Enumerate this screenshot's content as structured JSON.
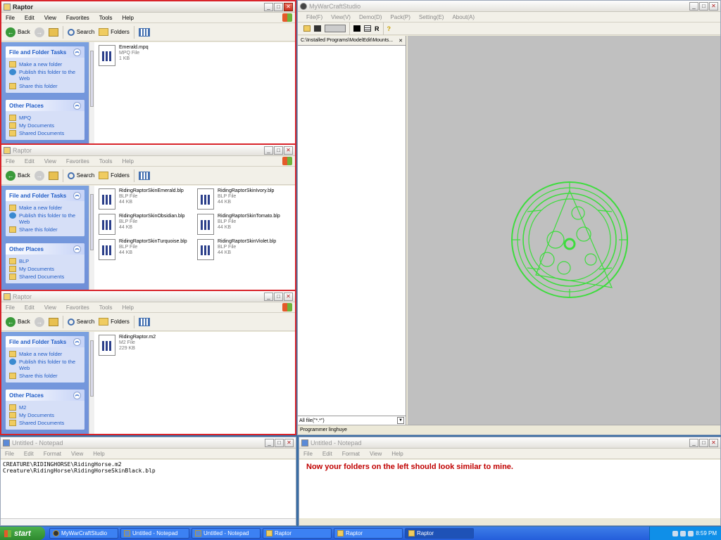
{
  "explorer_windows": [
    {
      "title": "Raptor",
      "menu": [
        "File",
        "Edit",
        "View",
        "Favorites",
        "Tools",
        "Help"
      ],
      "toolbar": {
        "back": "Back",
        "search": "Search",
        "folders": "Folders"
      },
      "tasks_panel": {
        "title": "File and Folder Tasks",
        "items": [
          "Make a new folder",
          "Publish this folder to the Web",
          "Share this folder"
        ]
      },
      "places_panel": {
        "title": "Other Places",
        "items": [
          "MPQ",
          "My Documents",
          "Shared Documents"
        ]
      },
      "files": [
        {
          "name": "Emerald.mpq",
          "type": "MPQ File",
          "size": "1 KB"
        }
      ]
    },
    {
      "title": "Raptor",
      "menu": [
        "File",
        "Edit",
        "View",
        "Favorites",
        "Tools",
        "Help"
      ],
      "toolbar": {
        "back": "Back",
        "search": "Search",
        "folders": "Folders"
      },
      "tasks_panel": {
        "title": "File and Folder Tasks",
        "items": [
          "Make a new folder",
          "Publish this folder to the Web",
          "Share this folder"
        ]
      },
      "places_panel": {
        "title": "Other Places",
        "items": [
          "BLP",
          "My Documents",
          "Shared Documents"
        ]
      },
      "files": [
        {
          "name": "RidingRaptorSkinEmerald.blp",
          "type": "BLP File",
          "size": "44 KB"
        },
        {
          "name": "RidingRaptorSkinIvory.blp",
          "type": "BLP File",
          "size": "44 KB"
        },
        {
          "name": "RidingRaptorSkinObsidian.blp",
          "type": "BLP File",
          "size": "44 KB"
        },
        {
          "name": "RidingRaptorSkinTomato.blp",
          "type": "BLP File",
          "size": "44 KB"
        },
        {
          "name": "RidingRaptorSkinTurquoise.blp",
          "type": "BLP File",
          "size": "44 KB"
        },
        {
          "name": "RidingRaptorSkinViolet.blp",
          "type": "BLP File",
          "size": "44 KB"
        }
      ]
    },
    {
      "title": "Raptor",
      "menu": [
        "File",
        "Edit",
        "View",
        "Favorites",
        "Tools",
        "Help"
      ],
      "toolbar": {
        "back": "Back",
        "search": "Search",
        "folders": "Folders"
      },
      "tasks_panel": {
        "title": "File and Folder Tasks",
        "items": [
          "Make a new folder",
          "Publish this folder to the Web",
          "Share this folder"
        ]
      },
      "places_panel": {
        "title": "Other Places",
        "items": [
          "M2",
          "My Documents",
          "Shared Documents"
        ]
      },
      "files": [
        {
          "name": "RidingRaptor.m2",
          "type": "M2 File",
          "size": "229 KB"
        }
      ]
    }
  ],
  "mwcs": {
    "title": "MyWarCraftStudio",
    "menu": [
      "File(F)",
      "View(V)",
      "Demo(D)",
      "Pack(P)",
      "Setting(E)",
      "About(A)"
    ],
    "tool_r": "R",
    "tab_path": "C:\\Installed Programs\\ModelEdit\\Mounts...",
    "filter": "All file(\"*.*\")",
    "status": "Programmer linghuye"
  },
  "notepad_left": {
    "title": "Untitled - Notepad",
    "menu": [
      "File",
      "Edit",
      "Format",
      "View",
      "Help"
    ],
    "lines": [
      "CREATURE\\RIDINGHORSE\\RidingHorse.m2",
      "Creature\\RidingHorse\\RidingHorseSkinBlack.blp"
    ]
  },
  "notepad_right": {
    "title": "Untitled - Notepad",
    "menu": [
      "File",
      "Edit",
      "Format",
      "View",
      "Help"
    ],
    "text": "Now your folders on the left should look similar to mine."
  },
  "taskbar": {
    "start": "start",
    "tasks": [
      "MyWarCraftStudio",
      "Untitled - Notepad",
      "Untitled - Notepad",
      "Raptor",
      "Raptor",
      "Raptor"
    ],
    "clock": "8:59 PM"
  },
  "colors": {
    "highlight": "#d8232a",
    "model": "#3ddc3d",
    "viewport": "#c0c0c0"
  }
}
